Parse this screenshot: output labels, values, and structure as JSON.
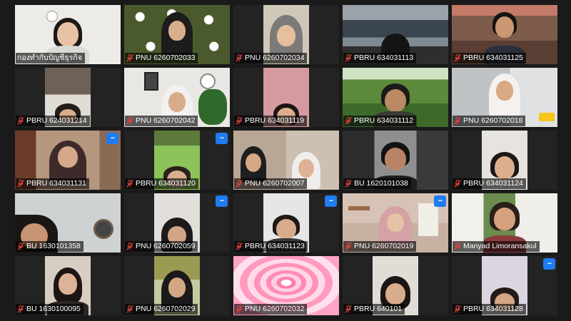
{
  "colors": {
    "background": "#1a1a1a",
    "tile": "#232323",
    "more_button": "#1f7cf2",
    "mic_muted": "#e8453c"
  },
  "more_icon": "...",
  "participants": [
    {
      "name": "กองทำกับปัญชีธุรกิจ",
      "muted": false,
      "more": false
    },
    {
      "name": "PNU 6260702033",
      "muted": true,
      "more": false
    },
    {
      "name": "PNU 6260702034",
      "muted": true,
      "more": false
    },
    {
      "name": "PBRU 634031113",
      "muted": true,
      "more": false
    },
    {
      "name": "PBRU 634031125",
      "muted": true,
      "more": false
    },
    {
      "name": "PBRU 624031214",
      "muted": true,
      "more": false
    },
    {
      "name": "PNU 6260702042",
      "muted": true,
      "more": false
    },
    {
      "name": "PBRU 634031119",
      "muted": true,
      "more": false
    },
    {
      "name": "PBRU 634031112",
      "muted": true,
      "more": false
    },
    {
      "name": "PNU 6260702018",
      "muted": true,
      "more": false
    },
    {
      "name": "PBRU 634031131",
      "muted": true,
      "more": true
    },
    {
      "name": "PBRU 634031120",
      "muted": true,
      "more": true
    },
    {
      "name": "PNU 6260702007",
      "muted": true,
      "more": false
    },
    {
      "name": "BU 1620101038",
      "muted": true,
      "more": false
    },
    {
      "name": "PBRU 634031124",
      "muted": true,
      "more": false
    },
    {
      "name": "BU 1630101358",
      "muted": true,
      "more": false
    },
    {
      "name": "PNU 6260702059",
      "muted": true,
      "more": true
    },
    {
      "name": "PBRU 634031123",
      "muted": true,
      "more": true
    },
    {
      "name": "PNU 6260702019",
      "muted": true,
      "more": true
    },
    {
      "name": "Manyad Limoransakul",
      "muted": true,
      "more": false
    },
    {
      "name": "BU 1630100095",
      "muted": true,
      "more": false
    },
    {
      "name": "PNU 6260702029",
      "muted": true,
      "more": false
    },
    {
      "name": "PNU 6260702032",
      "muted": true,
      "more": false
    },
    {
      "name": "PBRU 640101",
      "muted": true,
      "more": false
    },
    {
      "name": "PBRU 634031128",
      "muted": true,
      "more": true
    }
  ]
}
